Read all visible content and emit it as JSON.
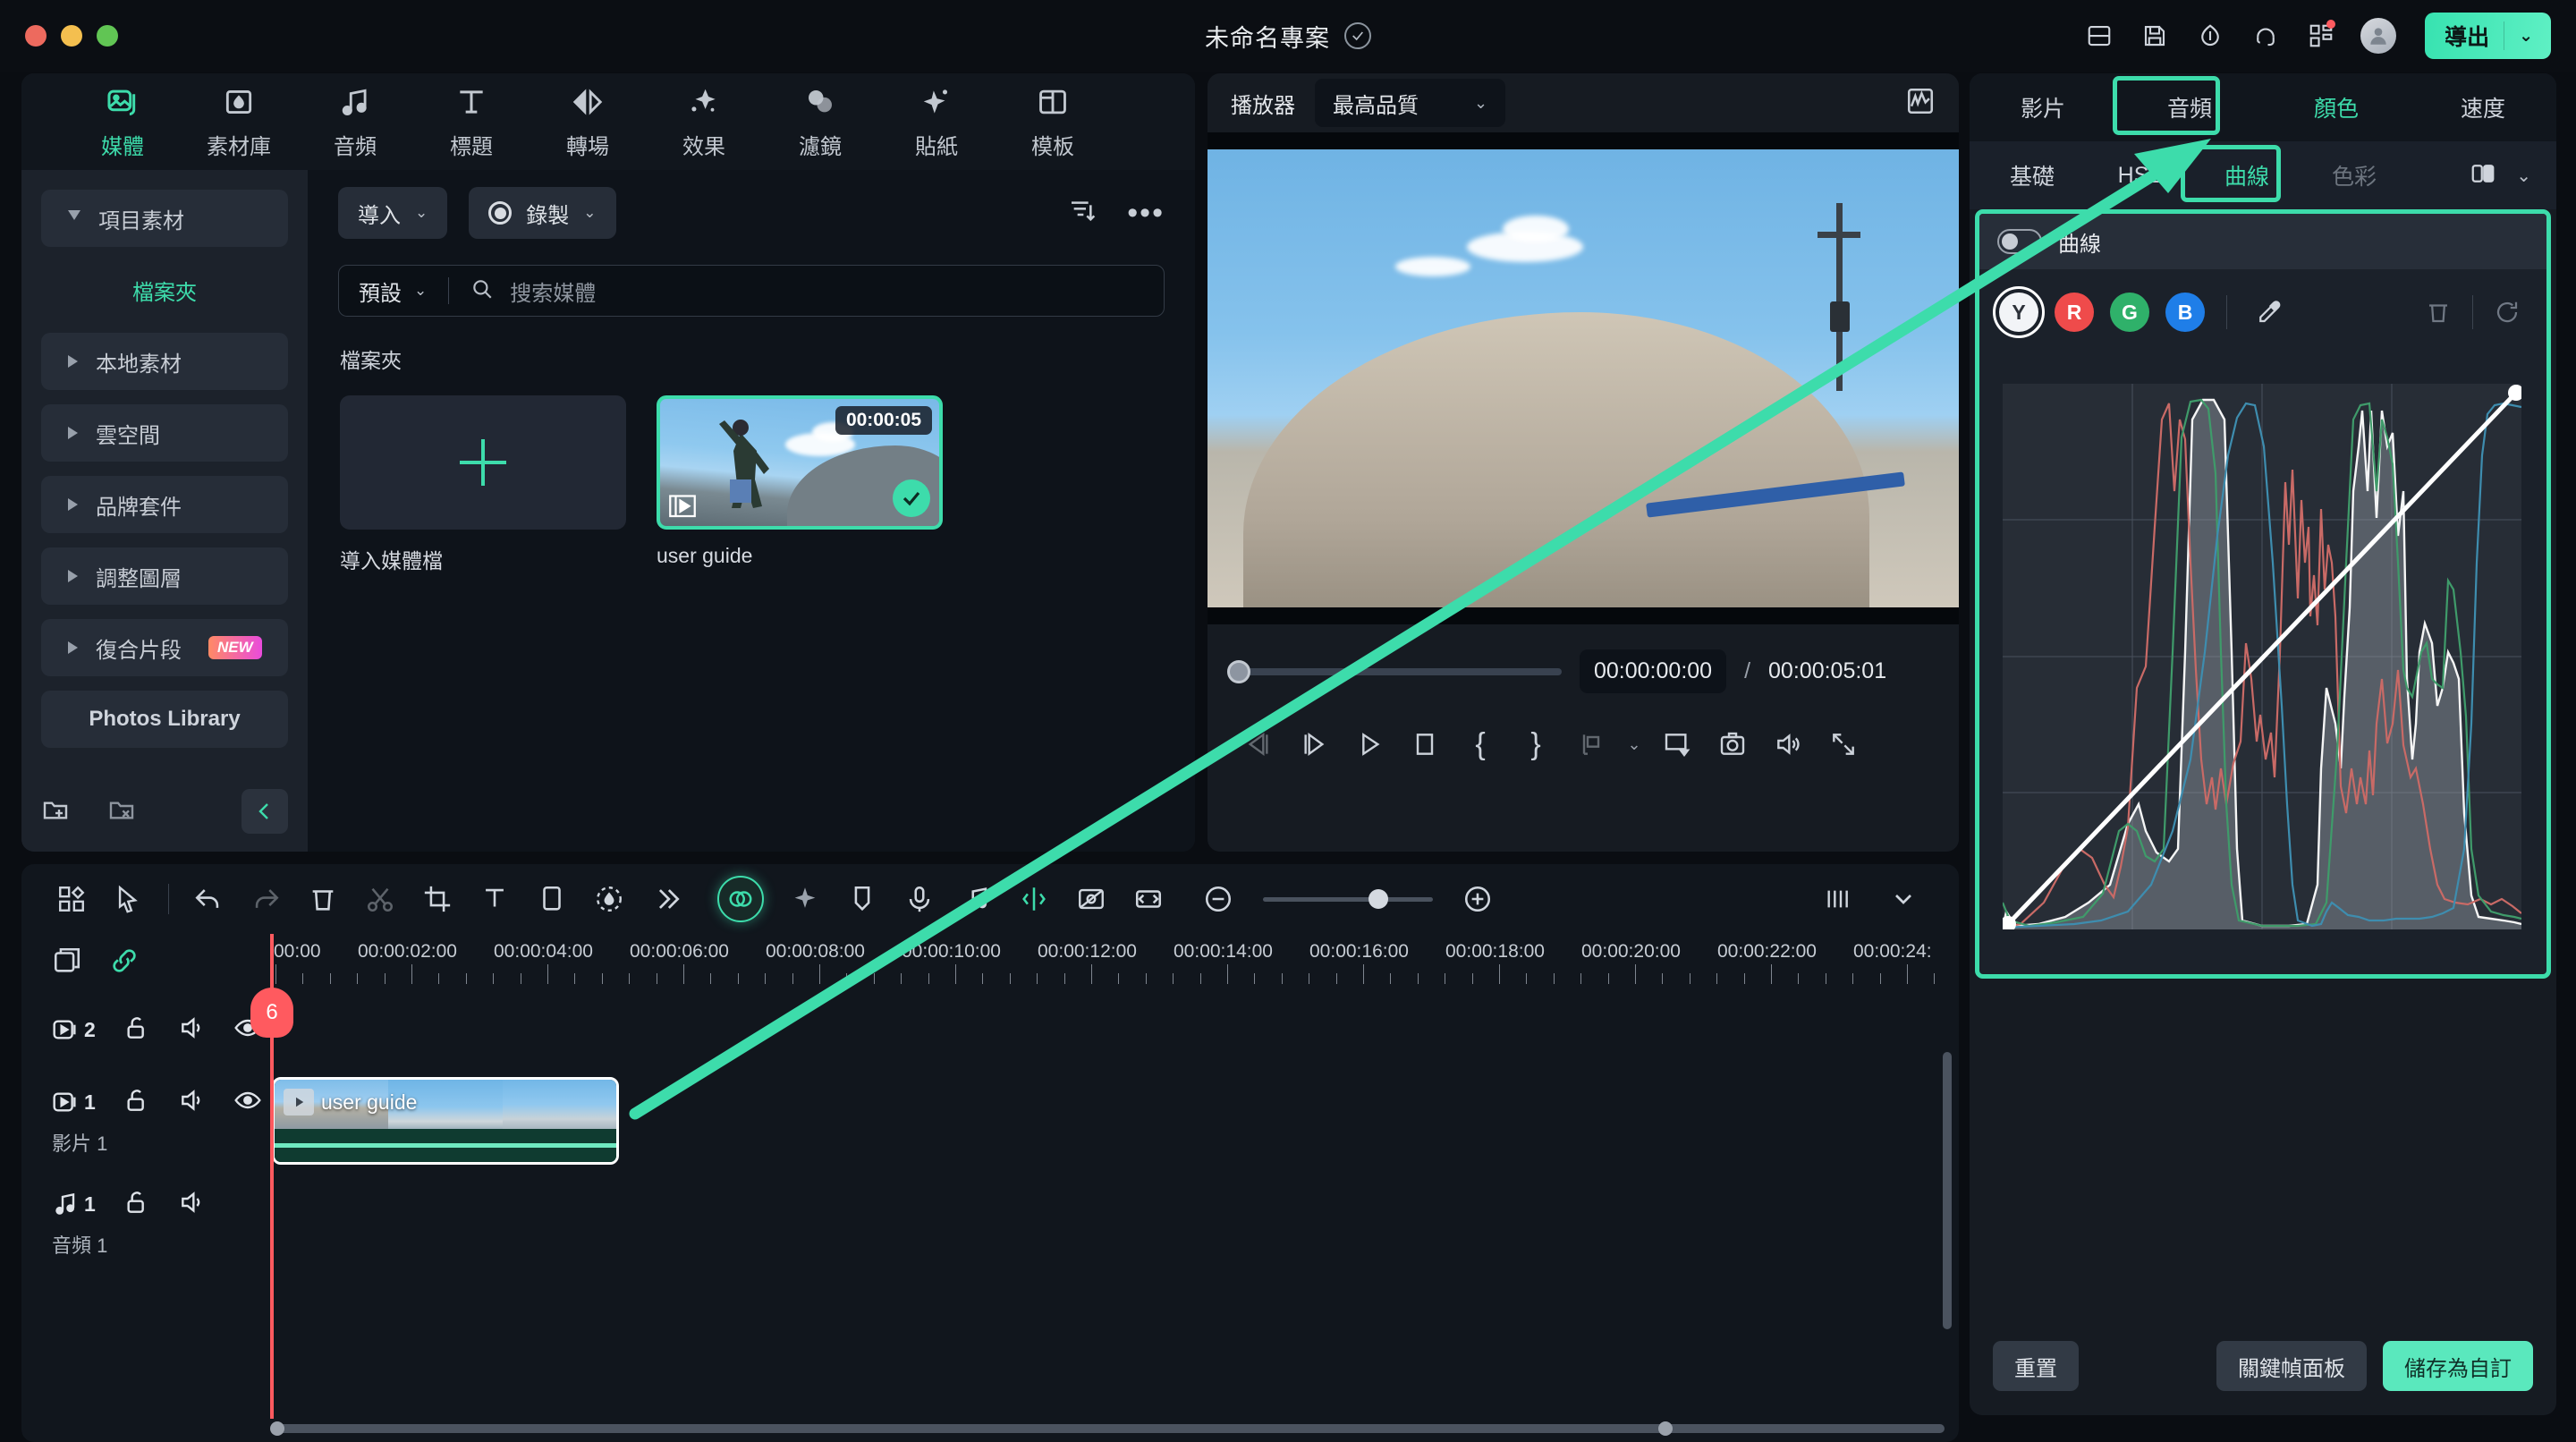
{
  "titlebar": {
    "project_title": "未命名專案",
    "icons": [
      "split-view-icon",
      "save-icon",
      "cloud-upload-icon",
      "headset-support-icon",
      "apps-grid-icon"
    ],
    "export_label": "導出",
    "export_chevron": "⌄"
  },
  "left_panel": {
    "tabs": [
      {
        "label": "媒體",
        "icon": "media-image-icon",
        "active": true
      },
      {
        "label": "素材庫",
        "icon": "stock-folder-icon",
        "active": false
      },
      {
        "label": "音頻",
        "icon": "music-note-icon",
        "active": false
      },
      {
        "label": "標題",
        "icon": "text-title-icon",
        "active": false
      },
      {
        "label": "轉場",
        "icon": "transition-arrows-icon",
        "active": false
      },
      {
        "label": "效果",
        "icon": "effects-sparkle-icon",
        "active": false
      },
      {
        "label": "濾鏡",
        "icon": "filters-circles-icon",
        "active": false
      },
      {
        "label": "貼紙",
        "icon": "sticker-star-icon",
        "active": false
      },
      {
        "label": "模板",
        "icon": "template-grid-icon",
        "active": false
      }
    ],
    "sidebar": [
      {
        "label": "項目素材",
        "arrow": "down",
        "style": "box"
      },
      {
        "label": "檔案夾",
        "arrow": "none",
        "style": "plain"
      },
      {
        "label": "本地素材",
        "arrow": "right",
        "style": "box"
      },
      {
        "label": "雲空間",
        "arrow": "right",
        "style": "box"
      },
      {
        "label": "品牌套件",
        "arrow": "right",
        "style": "box"
      },
      {
        "label": "調整圖層",
        "arrow": "right",
        "style": "box"
      },
      {
        "label": "復合片段",
        "arrow": "right",
        "style": "box",
        "badge": "NEW"
      },
      {
        "label": "Photos Library",
        "arrow": "none",
        "style": "noarrow"
      }
    ],
    "sidebar_bottom_icons": [
      "new-folder-icon",
      "delete-folder-icon",
      "collapse-panel-icon"
    ],
    "toolbar": {
      "import_label": "導入",
      "record_label": "錄製",
      "chevron": "⌄",
      "filter_icon": "filter-sort-icon",
      "more_icon": "more-options-icon"
    },
    "search": {
      "preset_label": "預設",
      "placeholder": "搜索媒體",
      "search_icon": "search-icon"
    },
    "folder_section_label": "檔案夾",
    "media_items": [
      {
        "type": "import",
        "caption": "導入媒體檔",
        "plus_icon": "plus-icon"
      },
      {
        "type": "clip",
        "caption": "user guide",
        "duration": "00:00:05",
        "selected": true,
        "film_icon": "film-strip-icon",
        "check_icon": "check-icon"
      }
    ]
  },
  "player": {
    "label": "播放器",
    "quality": "最高品質",
    "quality_chevron": "⌄",
    "scope_icon": "waveform-scope-icon",
    "current_time": "00:00:00:00",
    "separator": "/",
    "total_time": "00:00:05:01",
    "controls": [
      "prev-frame-icon",
      "next-frame-icon",
      "play-icon",
      "stop-icon",
      "mark-in-icon",
      "mark-out-icon",
      "render-bar-icon",
      "render-chevron-icon",
      "pop-out-icon",
      "snapshot-camera-icon",
      "volume-icon",
      "fullscreen-icon"
    ]
  },
  "right_panel": {
    "tabs": [
      {
        "label": "影片",
        "highlighted": false
      },
      {
        "label": "音頻",
        "highlighted": false
      },
      {
        "label": "顏色",
        "highlighted": true
      },
      {
        "label": "速度",
        "highlighted": false
      }
    ],
    "subtabs": [
      {
        "label": "基礎",
        "active": false
      },
      {
        "label": "HSL",
        "active": false
      },
      {
        "label": "曲線",
        "active": true
      },
      {
        "label": "色彩",
        "active": false,
        "dim": true
      }
    ],
    "subtab_right_icons": [
      "compare-split-icon",
      "more-chevron-icon"
    ],
    "curve_card": {
      "toggle_name": "curve-enable-toggle",
      "title": "曲線",
      "channels": [
        {
          "id": "Y",
          "selected": true,
          "color": "#f2f4f7"
        },
        {
          "id": "R",
          "selected": false,
          "color": "#ef4b4b"
        },
        {
          "id": "G",
          "selected": false,
          "color": "#2fb16a"
        },
        {
          "id": "B",
          "selected": false,
          "color": "#1f7ee8"
        }
      ],
      "tools": [
        "eyedropper-icon",
        "delete-icon",
        "reset-curve-icon"
      ]
    },
    "footer": {
      "reset_label": "重置",
      "keyframe_label": "關鍵幀面板",
      "save_preset_label": "儲存為自訂"
    }
  },
  "timeline": {
    "toolbar_icons": [
      "layout-grid-icon",
      "selection-tool-icon",
      "undo-icon",
      "redo-icon",
      "delete-icon",
      "split-scissors-icon",
      "crop-icon",
      "text-tool-icon",
      "shape-tool-icon",
      "mask-tool-icon",
      "more-chevrons-icon",
      "color-match-icon",
      "ai-sparkle-icon",
      "marker-icon",
      "voiceover-mic-icon",
      "audio-beat-icon",
      "auto-reframe-icon",
      "green-screen-icon",
      "fit-to-window-icon"
    ],
    "zoom_out_icon": "zoom-out-icon",
    "zoom_in_icon": "zoom-in-icon",
    "right_icons": [
      "track-view-icon",
      "track-chevron-icon"
    ],
    "header_icons": [
      "add-track-icon",
      "link-toggle-icon"
    ],
    "ruler_labels": [
      "00:00",
      "00:00:02:00",
      "00:00:04:00",
      "00:00:06:00",
      "00:00:08:00",
      "00:00:10:00",
      "00:00:12:00",
      "00:00:14:00",
      "00:00:16:00",
      "00:00:18:00",
      "00:00:20:00",
      "00:00:22:00",
      "00:00:24:"
    ],
    "playhead_marker": "6",
    "tracks": [
      {
        "kind": "video",
        "count": "2",
        "name": "",
        "icons": [
          "video-track-icon",
          "lock-open-icon",
          "mute-icon",
          "eye-icon"
        ],
        "clip": null
      },
      {
        "kind": "video",
        "count": "1",
        "name": "影片 1",
        "icons": [
          "video-track-icon",
          "lock-open-icon",
          "mute-icon",
          "eye-icon"
        ],
        "clip": {
          "label": "user guide",
          "play_icon": "play-small-icon"
        }
      },
      {
        "kind": "audio",
        "count": "1",
        "name": "音頻 1",
        "icons": [
          "audio-track-icon",
          "lock-open-icon",
          "mute-icon"
        ],
        "clip": null
      }
    ]
  },
  "colors": {
    "accent": "#3ddcab",
    "accent_strong": "#5ae8bd",
    "panel": "#161b22",
    "panel_dark": "#11161d",
    "playhead": "#ff5a5f",
    "new_badge_from": "#ff8a65",
    "new_badge_to": "#e94bdc"
  }
}
